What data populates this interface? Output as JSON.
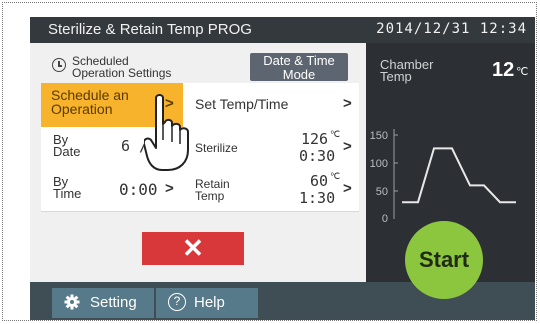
{
  "title": "Sterilize & Retain Temp PROG",
  "clock": "2014/12/31  12:34",
  "header": {
    "scheduled_line1": "Scheduled",
    "scheduled_line2": "Operation Settings",
    "datetime_line1": "Date & Time",
    "datetime_line2": "Mode"
  },
  "schedule": {
    "op_line1": "Schedule an",
    "op_line2": "Operation",
    "set_temp_time": "Set Temp/Time",
    "by_date_line1": "By",
    "by_date_line2": "Date",
    "by_date_value": "6 / 0",
    "by_time_line1": "By",
    "by_time_line2": "Time",
    "by_time_value": "0:00",
    "sterilize_label": "Sterilize",
    "sterilize_temp": "126",
    "sterilize_unit": "℃",
    "sterilize_time": "0:30",
    "retain_line1": "Retain",
    "retain_line2": "Temp",
    "retain_temp": "60",
    "retain_unit": "℃",
    "retain_time": "1:30",
    "cancel_symbol": "✕"
  },
  "chamber": {
    "label_line1": "Chamber",
    "label_line2": "Temp",
    "value": "12",
    "unit": "℃"
  },
  "chart_data": {
    "type": "line",
    "y_ticks": [
      "150",
      "100",
      "50",
      "0"
    ],
    "ylim": [
      0,
      150
    ],
    "profile": [
      {
        "x": 0,
        "y": 30
      },
      {
        "x": 1,
        "y": 30
      },
      {
        "x": 2,
        "y": 126
      },
      {
        "x": 3,
        "y": 126
      },
      {
        "x": 4,
        "y": 60
      },
      {
        "x": 5,
        "y": 60
      },
      {
        "x": 6,
        "y": 30
      },
      {
        "x": 7,
        "y": 30
      }
    ]
  },
  "bottom": {
    "setting": "Setting",
    "help": "Help",
    "help_symbol": "?"
  },
  "start": "Start",
  "colors": {
    "accent": "#f7b32b",
    "start": "#8cc63f",
    "cancel": "#d9383a"
  }
}
